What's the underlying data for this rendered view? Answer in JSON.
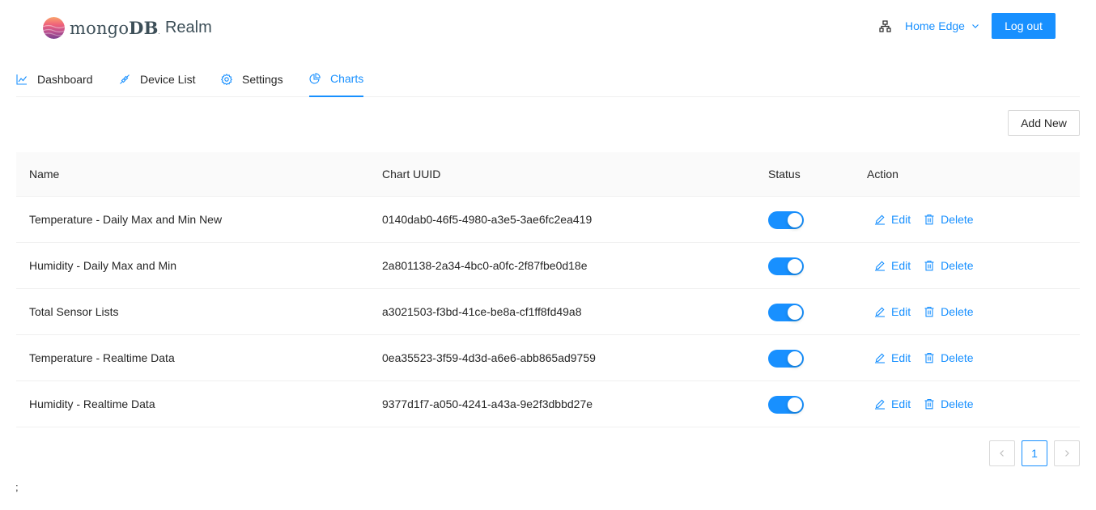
{
  "header": {
    "brand": {
      "word_left": "mongo",
      "word_right": "DB",
      "registered": ".",
      "product": "Realm"
    },
    "tenant": {
      "label": "Home Edge",
      "icon": "cluster-icon",
      "chevron": "chevron-down-icon"
    },
    "logout_label": "Log out"
  },
  "tabs": [
    {
      "label": "Dashboard",
      "icon": "line-chart-icon",
      "active": false
    },
    {
      "label": "Device List",
      "icon": "api-icon",
      "active": false
    },
    {
      "label": "Settings",
      "icon": "gear-icon",
      "active": false
    },
    {
      "label": "Charts",
      "icon": "pie-chart-icon",
      "active": true
    }
  ],
  "toolbar": {
    "add_new_label": "Add New"
  },
  "table": {
    "columns": [
      "Name",
      "Chart UUID",
      "Status",
      "Action"
    ],
    "rows": [
      {
        "name": "Temperature - Daily Max and Min New",
        "uuid": "0140dab0-46f5-4980-a3e5-3ae6fc2ea419",
        "status_on": true
      },
      {
        "name": "Humidity - Daily Max and Min",
        "uuid": "2a801138-2a34-4bc0-a0fc-2f87fbe0d18e",
        "status_on": true
      },
      {
        "name": "Total Sensor Lists",
        "uuid": "a3021503-f3bd-41ce-be8a-cf1ff8fd49a8",
        "status_on": true
      },
      {
        "name": "Temperature - Realtime Data",
        "uuid": "0ea35523-3f59-4d3d-a6e6-abb865ad9759",
        "status_on": true
      },
      {
        "name": "Humidity - Realtime Data",
        "uuid": "9377d1f7-a050-4241-a43a-9e2f3dbbd27e",
        "status_on": true
      }
    ],
    "edit_label": "Edit",
    "delete_label": "Delete",
    "edit_icon": "edit-icon",
    "delete_icon": "trash-icon"
  },
  "pagination": {
    "prev_icon": "chevron-left-icon",
    "current_page": "1",
    "next_icon": "chevron-right-icon"
  },
  "stray_text": ";",
  "colors": {
    "primary": "#1890ff",
    "border": "#f0f0f0",
    "header_bg": "#fafafa",
    "text": "#262626"
  }
}
